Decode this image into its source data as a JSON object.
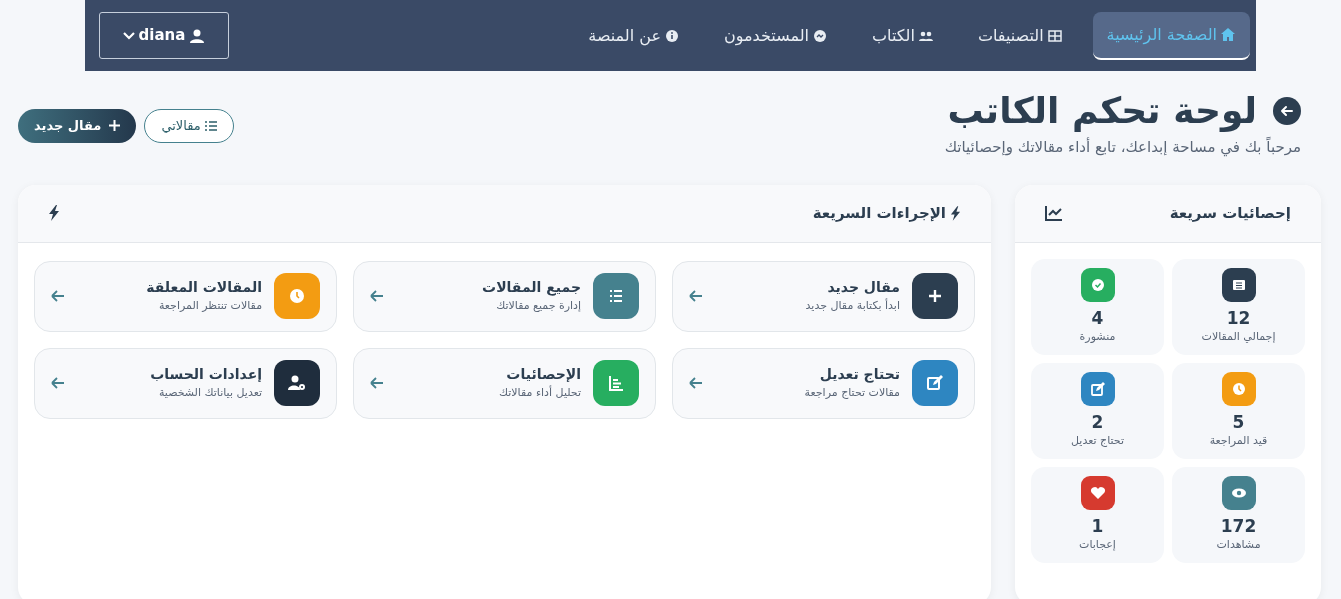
{
  "navbar": {
    "user_menu": {
      "label": "diana"
    },
    "items": [
      {
        "label": "الصفحة الرئيسية",
        "selected": true
      },
      {
        "label": "التصنيفات",
        "selected": false
      },
      {
        "label": "الكتاب",
        "selected": false
      },
      {
        "label": "المستخدمون",
        "selected": false
      },
      {
        "label": "عن المنصة",
        "selected": false
      }
    ]
  },
  "header": {
    "title": "لوحة تحكم الكاتب",
    "subtitle": "مرحباً بك في مساحة إبداعك، تابع أداء مقالاتك وإحصائياتك",
    "buttons": [
      {
        "label": "مقالاتي",
        "kind": "outline"
      },
      {
        "label": "مقال جديد",
        "kind": "solid"
      }
    ]
  },
  "quick_stats": {
    "title": "إحصائيات سريعة",
    "tiles": [
      {
        "value": "12",
        "label": "إجمالي المقالات",
        "color": "#2c3e50"
      },
      {
        "value": "4",
        "label": "منشورة",
        "color": "#27ae60"
      },
      {
        "value": "5",
        "label": "قيد المراجعة",
        "color": "#f39c12"
      },
      {
        "value": "2",
        "label": "تحتاج تعديل",
        "color": "#2e86c1"
      },
      {
        "value": "172",
        "label": "مشاهدات",
        "color": "#45818e"
      },
      {
        "value": "1",
        "label": "إعجابات",
        "color": "#d63a2f"
      }
    ]
  },
  "quick_actions": {
    "title": "الإجراءات السريعة",
    "items": [
      {
        "title": "مقال جديد",
        "subtitle": "ابدأ بكتابة مقال جديد",
        "color": "#2c3e50"
      },
      {
        "title": "جميع المقالات",
        "subtitle": "إدارة جميع مقالاتك",
        "color": "#45818e"
      },
      {
        "title": "المقالات المعلقة",
        "subtitle": "مقالات تنتظر المراجعة",
        "color": "#f39c12"
      },
      {
        "title": "تحتاج تعديل",
        "subtitle": "مقالات تحتاج مراجعة",
        "color": "#2e86c1"
      },
      {
        "title": "الإحصائيات",
        "subtitle": "تحليل أداء مقالاتك",
        "color": "#27ae60"
      },
      {
        "title": "إعدادات الحساب",
        "subtitle": "تعديل بياناتك الشخصية",
        "color": "#1f2d3d"
      }
    ]
  }
}
